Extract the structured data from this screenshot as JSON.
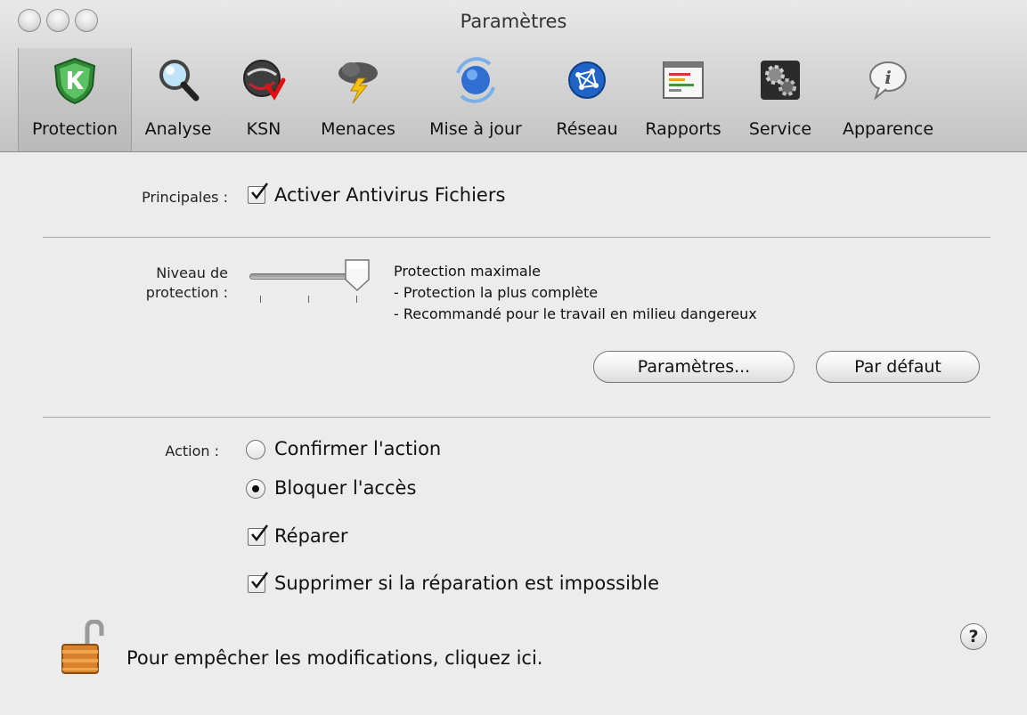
{
  "window": {
    "title": "Paramètres"
  },
  "toolbar": {
    "items": [
      {
        "label": "Protection",
        "icon": "shield-k-icon",
        "selected": true
      },
      {
        "label": "Analyse",
        "icon": "magnifier-icon"
      },
      {
        "label": "KSN",
        "icon": "ksn-globe-icon"
      },
      {
        "label": "Menaces",
        "icon": "storm-cloud-icon"
      },
      {
        "label": "Mise à jour",
        "icon": "update-globe-icon"
      },
      {
        "label": "Réseau",
        "icon": "network-icon"
      },
      {
        "label": "Rapports",
        "icon": "report-icon"
      },
      {
        "label": "Service",
        "icon": "gears-icon"
      },
      {
        "label": "Apparence",
        "icon": "info-bubble-icon"
      }
    ]
  },
  "main": {
    "principales_label": "Principales :",
    "enable_antivirus": {
      "label": "Activer Antivirus Fichiers",
      "checked": true
    },
    "level_label_line1": "Niveau de",
    "level_label_line2": "protection :",
    "slider": {
      "level": 3,
      "max": 3
    },
    "level_desc": [
      "Protection maximale",
      "- Protection la plus complète",
      "- Recommandé pour le travail en milieu dangereux"
    ],
    "settings_button": "Paramètres...",
    "default_button": "Par défaut",
    "action_label": "Action :",
    "action_options": [
      {
        "label": "Confirmer l'action",
        "selected": false
      },
      {
        "label": "Bloquer l'accès",
        "selected": true
      }
    ],
    "repair": {
      "label": "Réparer",
      "checked": true
    },
    "delete_if_impossible": {
      "label": "Supprimer si la réparation est impossible",
      "checked": true
    }
  },
  "footer": {
    "lock_text": "Pour empêcher les modifications, cliquez ici.",
    "help_label": "?"
  }
}
